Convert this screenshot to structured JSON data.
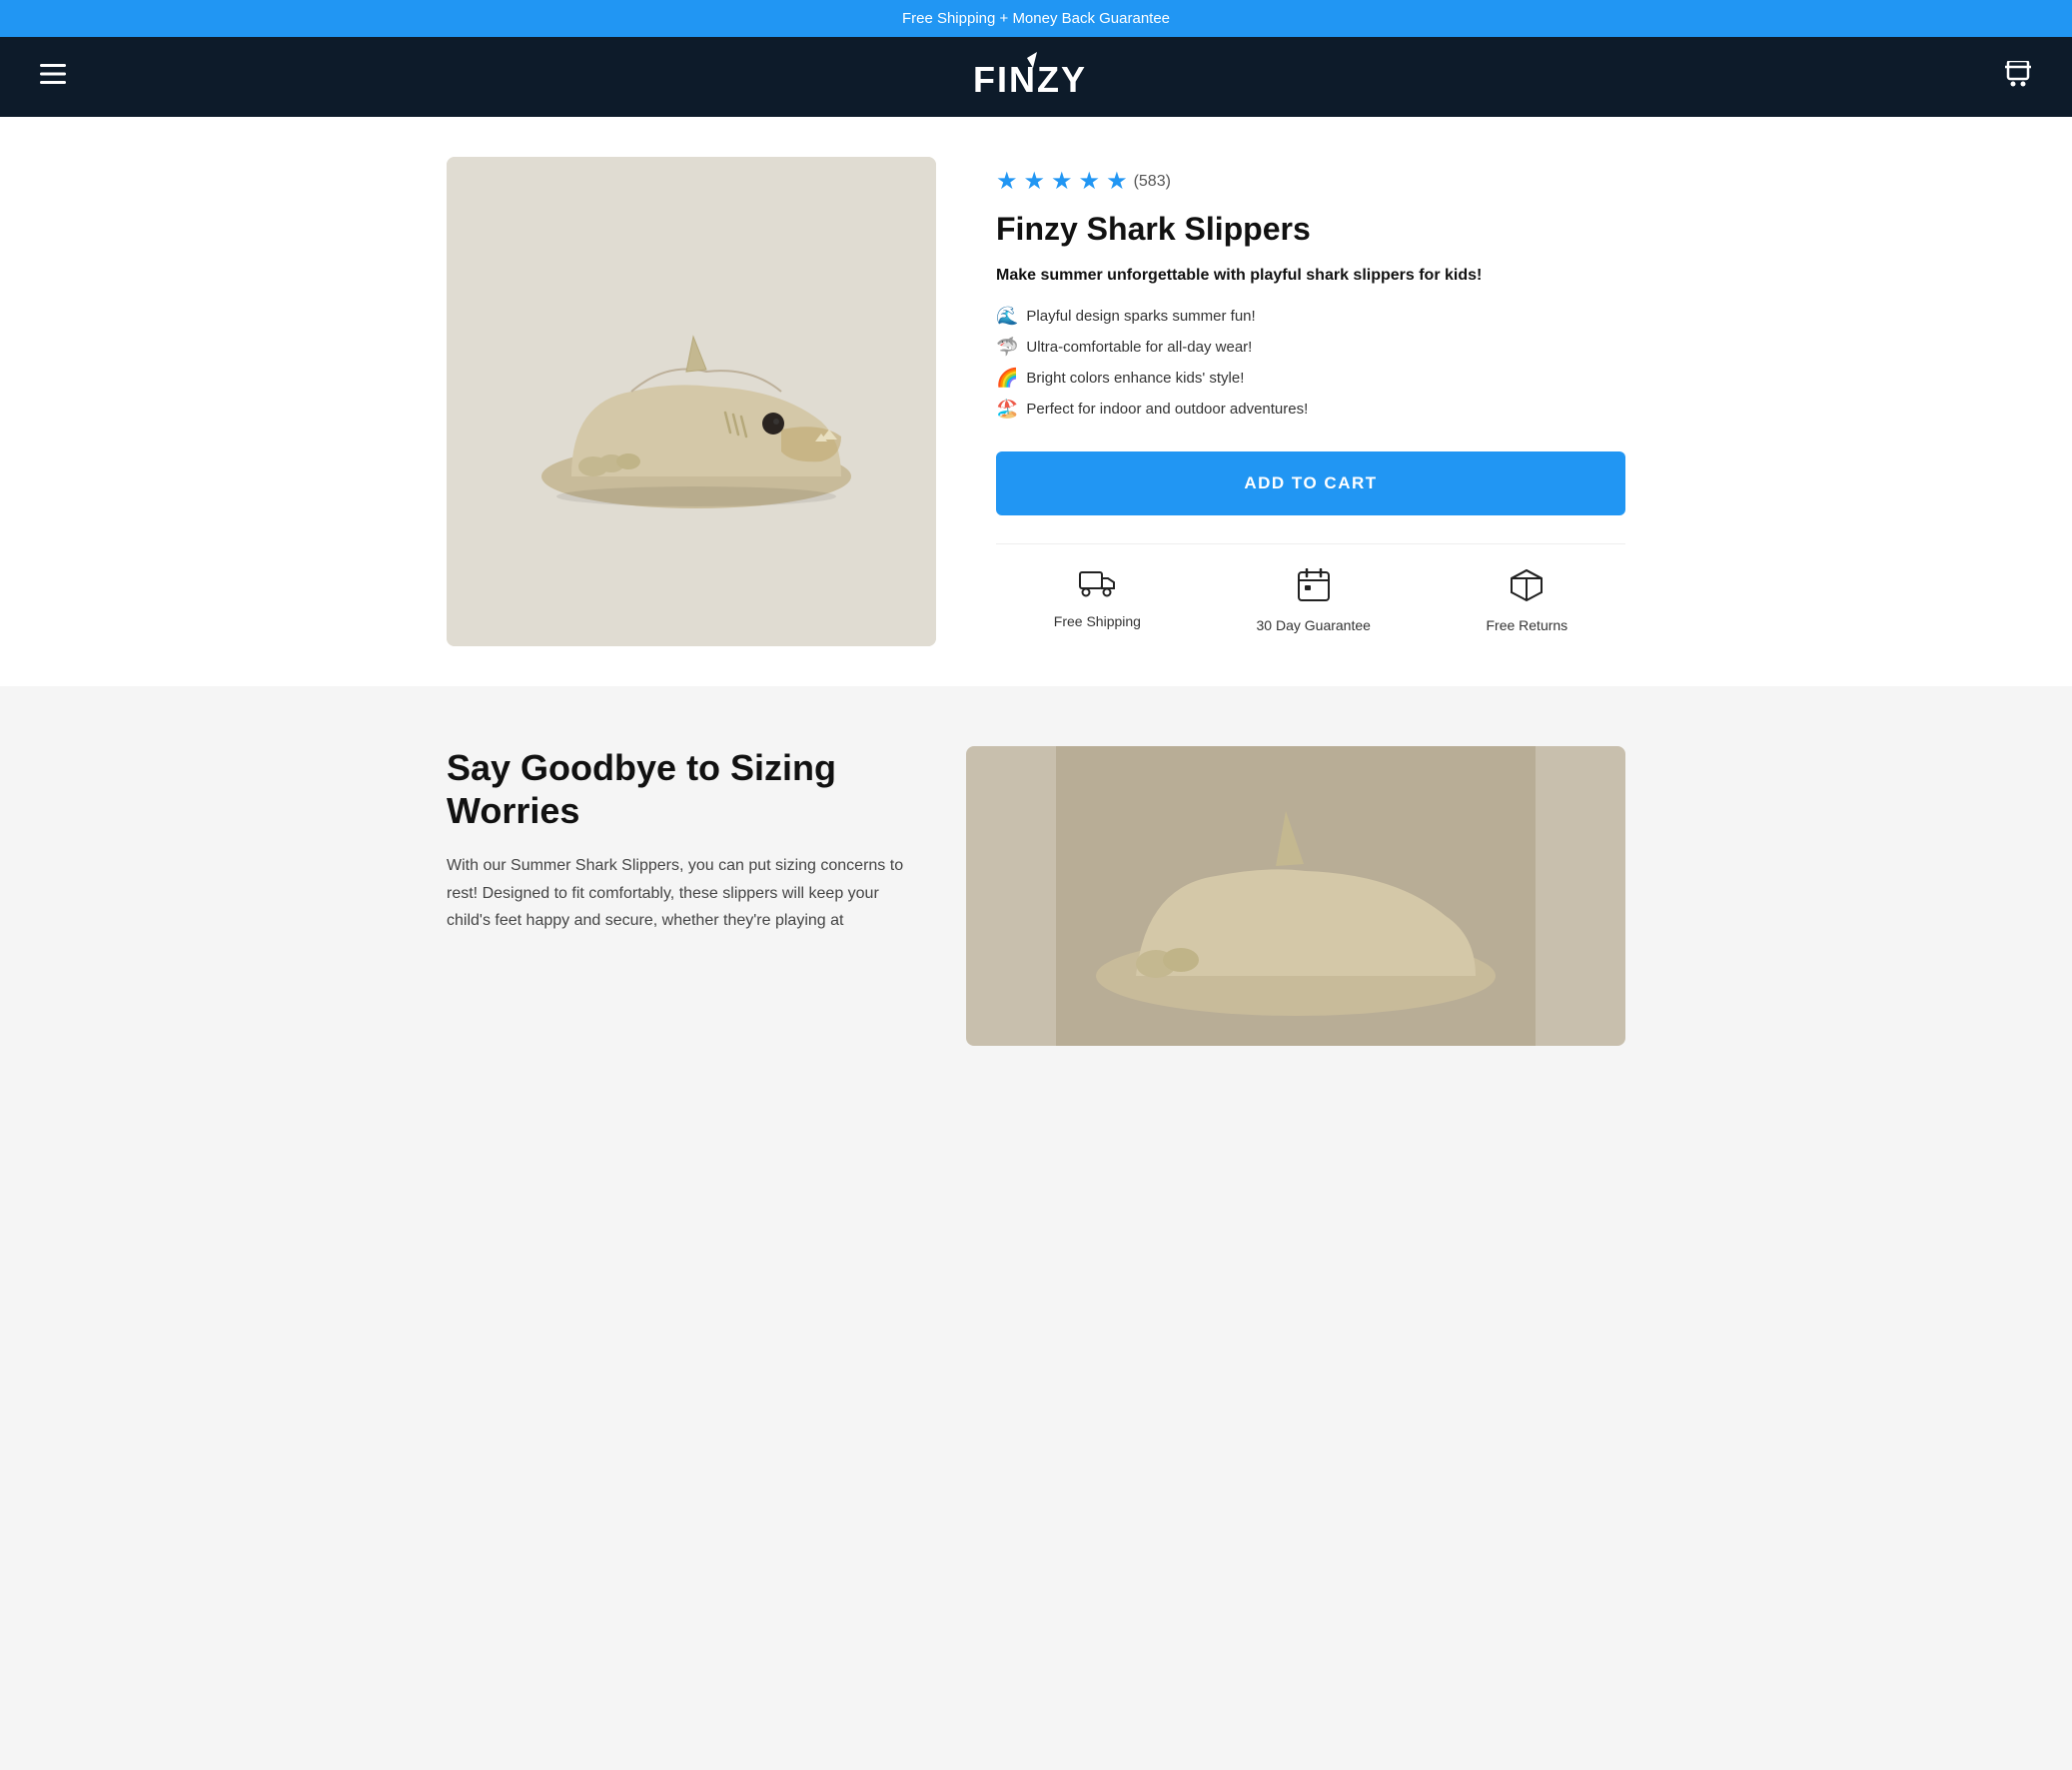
{
  "banner": {
    "text": "Free Shipping + Money Back Guarantee"
  },
  "header": {
    "logo_text": "FINZY",
    "menu_icon": "☰",
    "cart_icon": "🛒"
  },
  "product": {
    "rating": 5,
    "review_count": "(583)",
    "title": "Finzy Shark Slippers",
    "tagline": "Make summer unforgettable with playful shark slippers for kids!",
    "features": [
      {
        "emoji": "🌊",
        "text": "Playful design sparks summer fun!"
      },
      {
        "emoji": "🦈",
        "text": "Ultra-comfortable for all-day wear!"
      },
      {
        "emoji": "🌈",
        "text": "Bright colors enhance kids' style!"
      },
      {
        "emoji": "🏖️",
        "text": "Perfect for indoor and outdoor adventures!"
      }
    ],
    "add_to_cart_label": "ADD TO CART",
    "badges": [
      {
        "label": "Free Shipping",
        "icon": "truck"
      },
      {
        "label": "30 Day Guarantee",
        "icon": "calendar"
      },
      {
        "label": "Free Returns",
        "icon": "box"
      }
    ]
  },
  "lower": {
    "title": "Say Goodbye to Sizing Worries",
    "description": "With our Summer Shark Slippers, you can put sizing concerns to rest! Designed to fit comfortably, these slippers will keep your child's feet happy and secure, whether they're playing at"
  }
}
